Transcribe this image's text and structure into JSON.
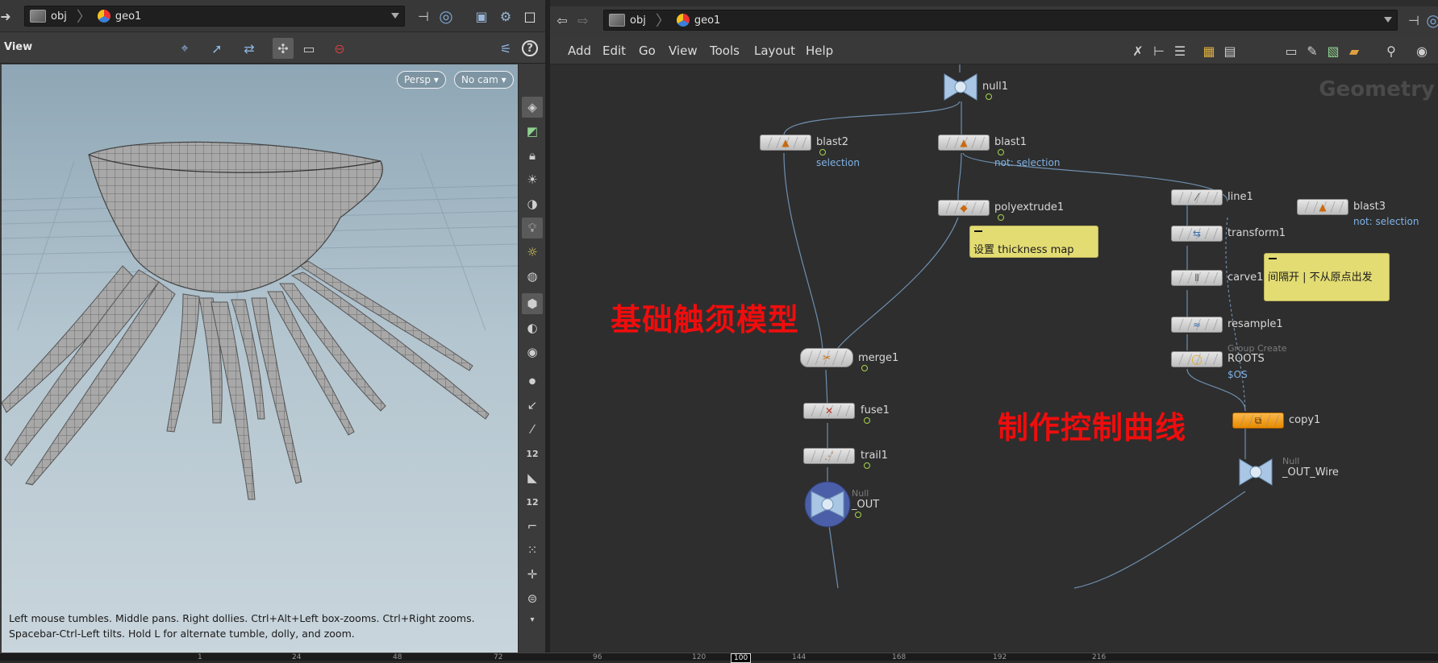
{
  "left_pane": {
    "path": {
      "root": "obj",
      "child": "geo1"
    },
    "view_title": "View",
    "viewport": {
      "camera_mode": "Persp",
      "camera": "No cam",
      "hint_line1": "Left mouse tumbles. Middle pans. Right dollies. Ctrl+Alt+Left box-zooms. Ctrl+Right zooms.",
      "hint_line2": "Spacebar-Ctrl-Left tilts. Hold L for alternate tumble, dolly, and zoom."
    },
    "side_tools": {
      "snap_count_1": "12",
      "snap_count_2": "12"
    }
  },
  "right_pane": {
    "path": {
      "root": "obj",
      "child": "geo1"
    },
    "menu": [
      "Add",
      "Edit",
      "Go",
      "View",
      "Tools",
      "Layout",
      "Help"
    ],
    "context_label": "Geometry",
    "nodes": {
      "null1": "null1",
      "blast2": "blast2",
      "blast2_sub": "selection",
      "blast1": "blast1",
      "blast1_sub": "not: selection",
      "polyextrude1": "polyextrude1",
      "merge1": "merge1",
      "fuse1": "fuse1",
      "trail1": "trail1",
      "out_type": "Null",
      "out_name": "_OUT",
      "line1": "line1",
      "transform1": "transform1",
      "carve1": "carve1",
      "resample1": "resample1",
      "roots_type": "Group Create",
      "roots_name": "ROOTS",
      "roots_sub": "$OS",
      "blast3": "blast3",
      "blast3_sub": "not: selection",
      "copy1": "copy1",
      "outwire_type": "Null",
      "outwire_name": "_OUT_Wire"
    },
    "sticky_notes": {
      "thickness": "设置 thickness map",
      "spacing": "间隔开 | 不从原点出发"
    },
    "annotations": {
      "base_model": "基础触须模型",
      "control_curves": "制作控制曲线"
    },
    "colors": {
      "annotation": "#ee0d0d",
      "sticky": "#e3dc73",
      "copy_node": "#f2a11c"
    }
  },
  "timeline": {
    "ticks": [
      "1",
      "24",
      "48",
      "72",
      "96",
      "120",
      "144",
      "168",
      "192",
      "216"
    ],
    "current_frame": "100"
  }
}
